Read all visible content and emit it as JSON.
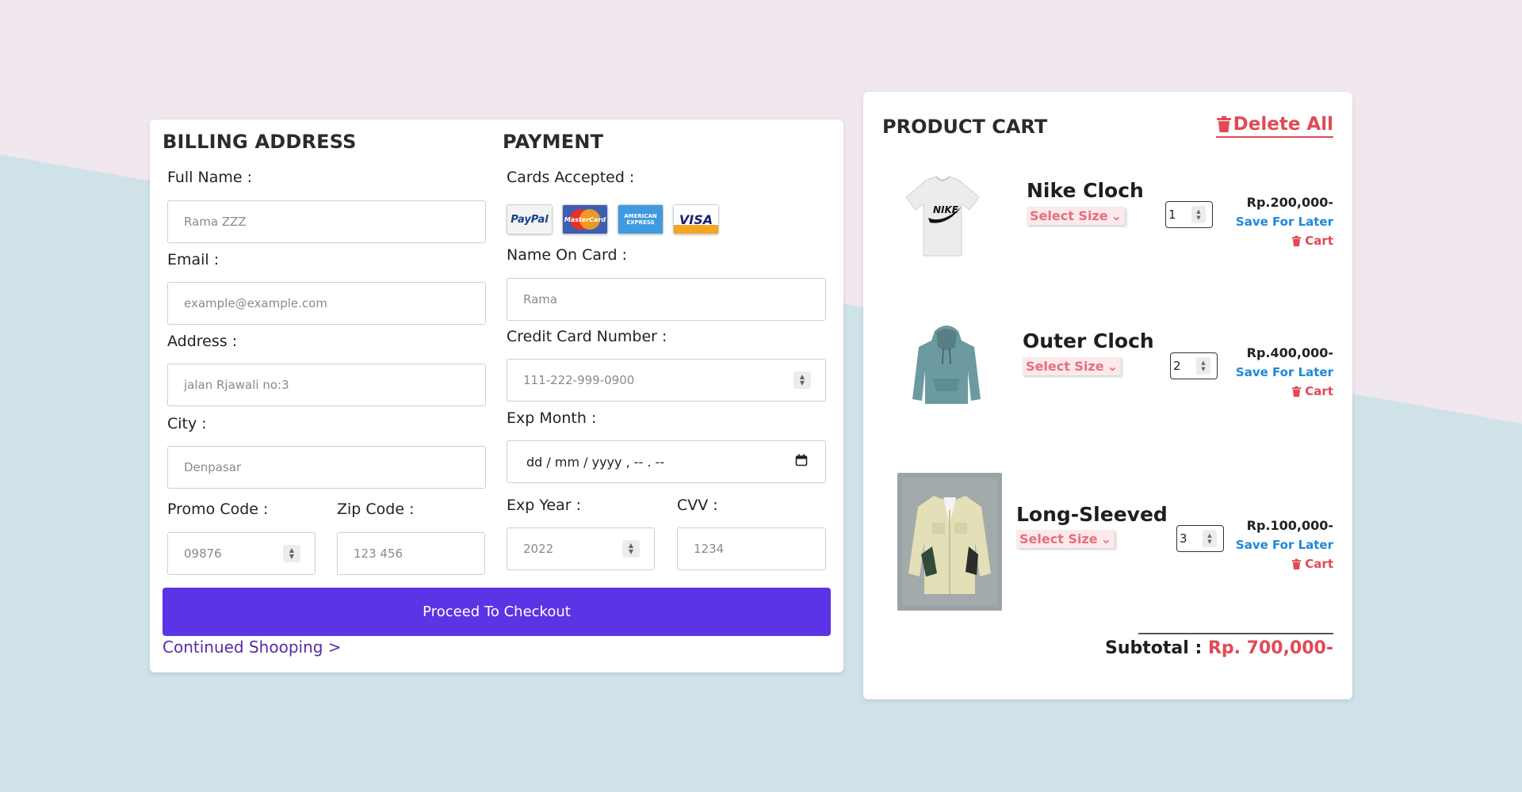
{
  "colors": {
    "background_top": "#f1e7ef",
    "background_bottom": "#cfe2e8",
    "accent": "#5b35e5",
    "link": "#5b2aa7",
    "danger": "#e04a55",
    "save_link": "#1e88d8"
  },
  "billing": {
    "title": "BILLING ADDRESS",
    "full_name": {
      "label": "Full Name :",
      "placeholder": "Rama ZZZ"
    },
    "email": {
      "label": "Email :",
      "placeholder": "example@example.com"
    },
    "address": {
      "label": "Address :",
      "placeholder": "jalan Rjawali no:3"
    },
    "city": {
      "label": "City :",
      "placeholder": "Denpasar"
    },
    "promo": {
      "label": "Promo Code :",
      "placeholder": "09876"
    },
    "zip": {
      "label": "Zip Code :",
      "placeholder": "123 456"
    }
  },
  "payment": {
    "title": "PAYMENT",
    "cards_label": "Cards Accepted :",
    "cards": [
      {
        "name": "PayPal",
        "icon": "paypal-icon"
      },
      {
        "name": "MasterCard",
        "icon": "mastercard-icon"
      },
      {
        "name": "AMERICAN EXPRESS",
        "icon": "amex-icon"
      },
      {
        "name": "VISA",
        "icon": "visa-icon"
      }
    ],
    "name_on_card": {
      "label": "Name On Card :",
      "placeholder": "Rama"
    },
    "card_number": {
      "label": "Credit Card Number :",
      "placeholder": "111-222-999-0900"
    },
    "exp_month": {
      "label": "Exp Month :",
      "value": "dd / mm / yyyy , -- . --"
    },
    "exp_year": {
      "label": "Exp Year :",
      "placeholder": "2022"
    },
    "cvv": {
      "label": "CVV :",
      "placeholder": "1234"
    }
  },
  "checkout_button": "Proceed To Checkout",
  "continue_link": "Continued Shooping >",
  "cart": {
    "title": "PRODUCT CART",
    "delete_all": "Delete All",
    "items": [
      {
        "name": "Nike Cloch",
        "size_label": "Select Size",
        "qty": "1",
        "price": "Rp.200,000-",
        "save": "Save For Later",
        "remove": "Cart",
        "image": "nike-tshirt"
      },
      {
        "name": "Outer Cloch",
        "size_label": "Select Size",
        "qty": "2",
        "price": "Rp.400,000-",
        "save": "Save For Later",
        "remove": "Cart",
        "image": "hoodie"
      },
      {
        "name": "Long-Sleeved",
        "size_label": "Select Size",
        "qty": "3",
        "price": "Rp.100,000-",
        "save": "Save For Later",
        "remove": "Cart",
        "image": "long-sleeved-jacket"
      }
    ],
    "subtotal_label": "Subtotal :",
    "subtotal_value": "Rp. 700,000-"
  }
}
